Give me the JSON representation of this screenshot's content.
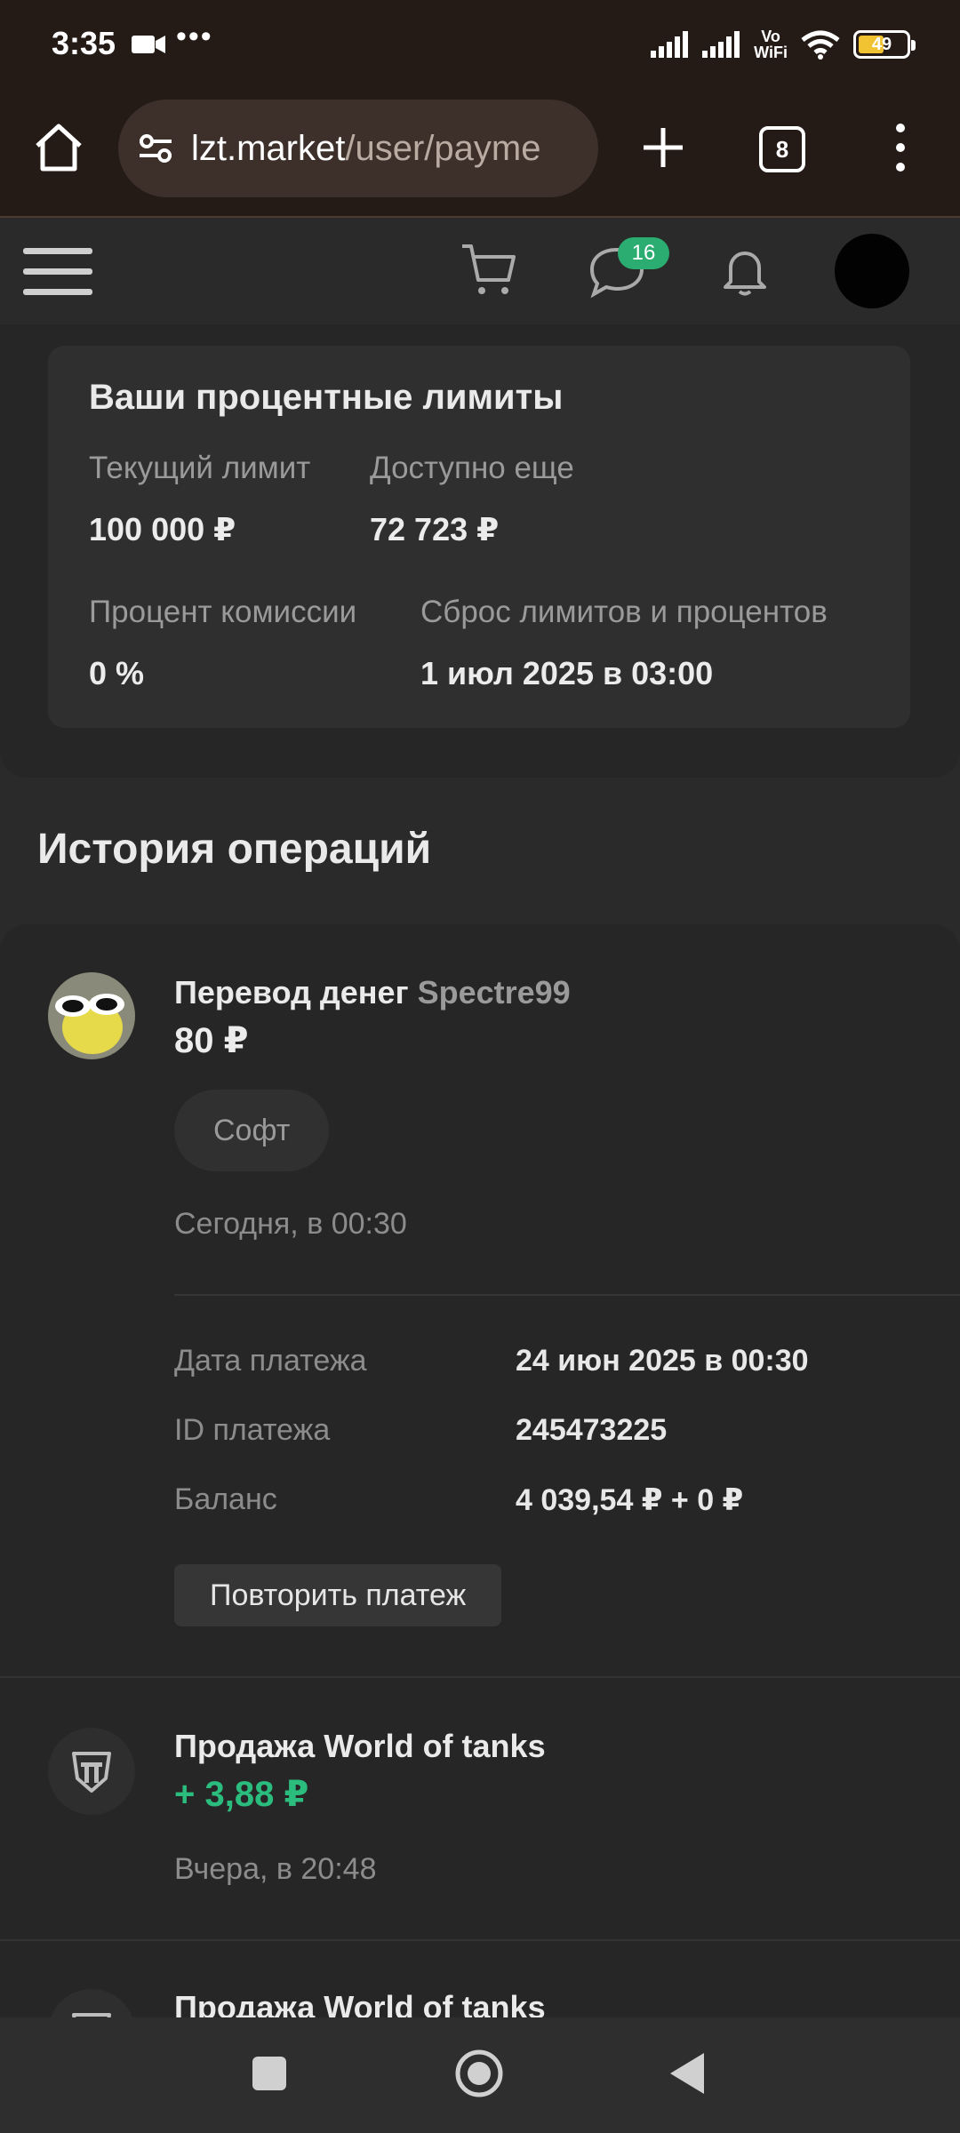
{
  "status_bar": {
    "time": "3:35",
    "dots": "•••",
    "volte": "Vo\nWiFi",
    "battery": "49"
  },
  "browser": {
    "url_host": "lzt.market",
    "url_path": "/user/payme",
    "tab_count": "8"
  },
  "header": {
    "chat_badge": "16"
  },
  "limits": {
    "title": "Ваши процентные лимиты",
    "current_limit_label": "Текущий лимит",
    "current_limit_value": "100 000 ₽",
    "available_label": "Доступно еще",
    "available_value": "72 723 ₽",
    "commission_label": "Процент комиссии",
    "commission_value": "0 %",
    "reset_label": "Сброс лимитов и процентов",
    "reset_value": "1 июл 2025 в 03:00"
  },
  "history": {
    "title": "История операций",
    "operations": [
      {
        "title": "Перевод денег",
        "user": "Spectre99",
        "amount": "80 ₽",
        "tag": "Софт",
        "time": "Сегодня, в 00:30",
        "details": [
          {
            "label": "Дата платежа",
            "value": "24 июн 2025 в 00:30"
          },
          {
            "label": "ID платежа",
            "value": "245473225"
          },
          {
            "label": "Баланс",
            "value": "4 039,54 ₽ + 0 ₽"
          }
        ],
        "repeat_label": "Повторить платеж"
      },
      {
        "title": "Продажа World of tanks",
        "amount": "+ 3,88 ₽",
        "time": "Вчера, в 20:48"
      },
      {
        "title": "Продажа World of tanks"
      }
    ]
  },
  "colors": {
    "accent_green": "#2bbd7e",
    "badge_green": "#2bad72",
    "browser_bar": "#241b16"
  }
}
